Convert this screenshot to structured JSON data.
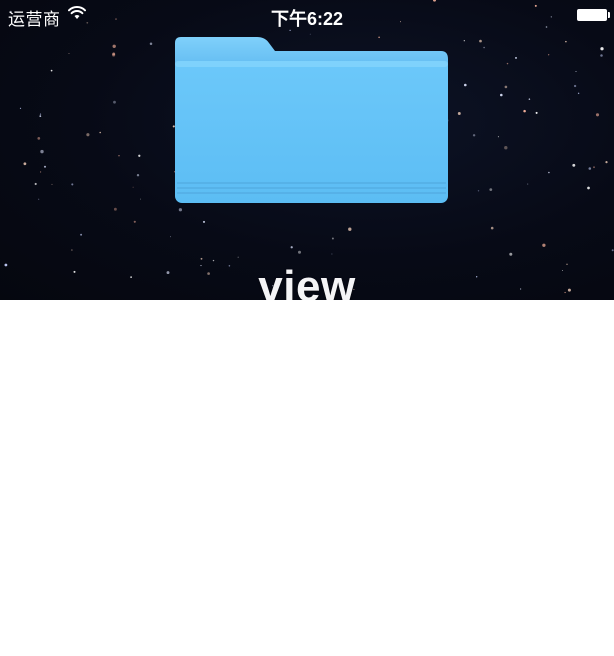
{
  "status_bar": {
    "carrier": "运营商",
    "time": "下午6:22",
    "wifi_icon": "wifi-icon",
    "battery_icon": "battery-full-icon"
  },
  "preview": {
    "folder_icon": "folder-icon",
    "folder_name": "view",
    "folder_color": "#5fbcf5",
    "wallpaper_color": "#070a16"
  },
  "colors": {
    "blank_background": "#ffffff"
  }
}
